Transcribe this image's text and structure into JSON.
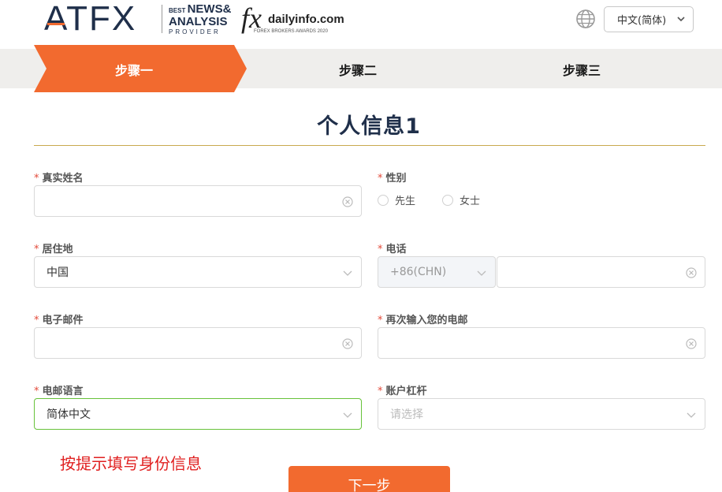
{
  "header": {
    "logo_text": "ATFX",
    "award_line1": "BEST",
    "award_line1b": "NEWS&",
    "award_line2": "ANALYSIS",
    "award_line3": "PROVIDER",
    "fx_logo_fx": "fx",
    "fx_logo_site": "dailyinfo.com",
    "fx_logo_award": "FOREX BROKERS AWARDS 2020",
    "language_selected": "中文(简体)"
  },
  "steps": [
    {
      "label": "步骤一",
      "active": true
    },
    {
      "label": "步骤二",
      "active": false
    },
    {
      "label": "步骤三",
      "active": false
    }
  ],
  "form": {
    "title": "个人信息1",
    "required_mark": "*",
    "real_name": {
      "label": "真实姓名",
      "value": ""
    },
    "gender": {
      "label": "性别",
      "options": [
        "先生",
        "女士"
      ]
    },
    "residence": {
      "label": "居住地",
      "value": "中国"
    },
    "phone": {
      "label": "电话",
      "code": "+86(CHN)",
      "value": ""
    },
    "email": {
      "label": "电子邮件",
      "value": ""
    },
    "email_confirm": {
      "label": "再次输入您的电邮",
      "value": ""
    },
    "email_language": {
      "label": "电邮语言",
      "value": "简体中文"
    },
    "leverage": {
      "label": "账户杠杆",
      "placeholder": "请选择"
    }
  },
  "hint": "按提示填写身份信息",
  "next_button": "下一步",
  "colors": {
    "accent": "#f26a2f",
    "navy": "#1f2f4a",
    "focus": "#67c23a",
    "required": "#e34a3a"
  }
}
